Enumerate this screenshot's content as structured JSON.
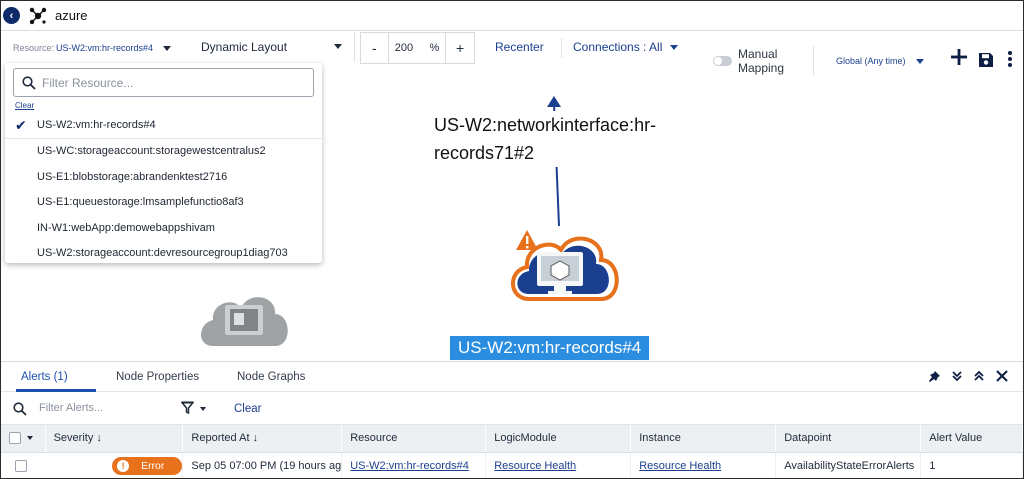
{
  "app": {
    "title": "azure"
  },
  "toolbar": {
    "resource_label": "Resource:",
    "resource_value": "US-W2:vm:hr-records#4",
    "layout": "Dynamic Layout",
    "zoom_minus": "-",
    "zoom_value": "200",
    "zoom_unit": "%",
    "zoom_plus": "+",
    "recenter": "Recenter",
    "connections": "Connections : All",
    "manual_mapping": "Manual Mapping",
    "time_range": "Global (Any time)"
  },
  "resource_dropdown": {
    "filter_placeholder": "Filter Resource...",
    "clear": "Clear",
    "items": [
      {
        "label": "US-W2:vm:hr-records#4",
        "selected": true
      },
      {
        "label": "US-WC:storageaccount:storagewestcentralus2",
        "selected": false
      },
      {
        "label": "US-E1:blobstorage:abrandenktest2716",
        "selected": false
      },
      {
        "label": "US-E1:queuestorage:lmsamplefunctio8af3",
        "selected": false
      },
      {
        "label": "IN-W1:webApp:demowebappshivam",
        "selected": false
      },
      {
        "label": "US-W2:storageaccount:devresourcegroup1diag703",
        "selected": false
      }
    ]
  },
  "map": {
    "edge_label": "US-W2:networkinterface:hr-records71#2",
    "node_label": "US-W2:vm:hr-records#4"
  },
  "colors": {
    "accent": "#1b4fae",
    "node_selected": "#2b8de0",
    "error": "#e8711c",
    "navy": "#0d2b6b"
  },
  "panel": {
    "tabs": [
      {
        "label": "Alerts (1)",
        "active": true
      },
      {
        "label": "Node Properties",
        "active": false
      },
      {
        "label": "Node Graphs",
        "active": false
      }
    ],
    "filter_placeholder": "Filter Alerts...",
    "clear": "Clear",
    "columns": [
      "Severity",
      "Reported At",
      "Resource",
      "LogicModule",
      "Instance",
      "Datapoint",
      "Alert Value"
    ],
    "rows": [
      {
        "severity": "Error",
        "reported_at": "Sep 05 07:00 PM  (19 hours ag",
        "resource": "US-W2:vm:hr-records#4",
        "logic_module": "Resource Health",
        "instance": "Resource Health",
        "datapoint": "AvailabilityStateErrorAlerts",
        "alert_value": "1"
      }
    ]
  }
}
